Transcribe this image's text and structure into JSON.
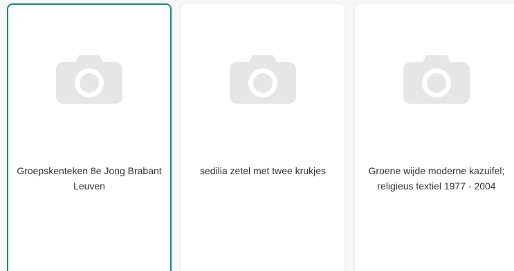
{
  "cards": [
    {
      "title": "Groepskenteken 8e Jong Brabant Leuven",
      "image_icon": "camera-icon",
      "selected": true
    },
    {
      "title": "sedilia zetel met twee krukjes",
      "image_icon": "camera-icon",
      "selected": false
    },
    {
      "title": "Groene wijde moderne kazuifel; religieus textiel 1977 - 2004",
      "image_icon": "camera-icon",
      "selected": false
    }
  ],
  "colors": {
    "selected_border": "#1b8a86",
    "placeholder_icon": "#e6e6e6",
    "text": "#333333"
  }
}
